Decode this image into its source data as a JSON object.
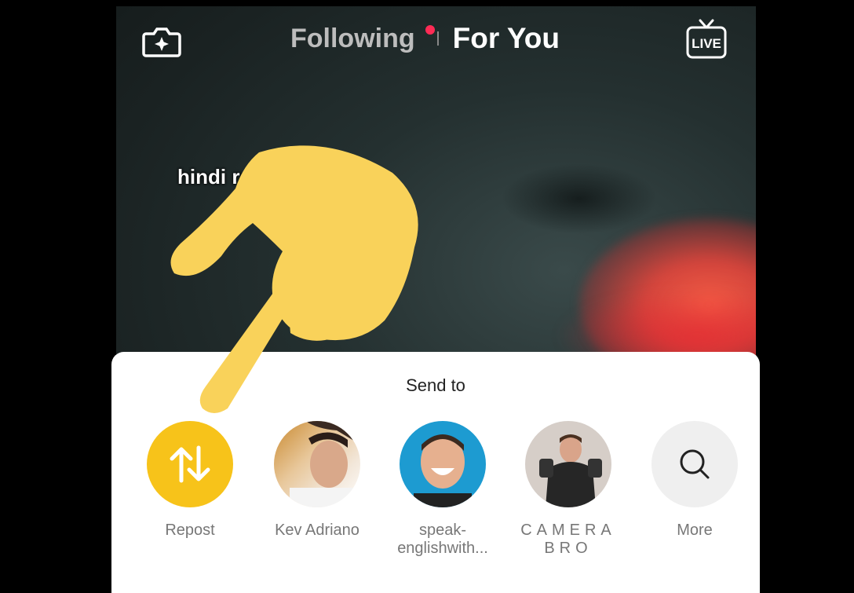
{
  "topbar": {
    "following_label": "Following",
    "for_you_label": "For You",
    "camera_icon": "camera-plus-icon",
    "live_icon": "live-tv-icon",
    "live_text": "LIVE",
    "notification_dot_color": "#ff2b55"
  },
  "video": {
    "caption": "hindi ras pt5"
  },
  "share_sheet": {
    "title": "Send to",
    "contacts": [
      {
        "label": "Repost",
        "icon": "repost-icon",
        "color": "#f7c31a"
      },
      {
        "label": "Kev Adriano",
        "icon": "avatar"
      },
      {
        "label_line1": "speak-",
        "label_line2": "englishwith...",
        "icon": "avatar",
        "color": "#1d9bd1"
      },
      {
        "label_line1": "CAMERA",
        "label_line2": "BRO",
        "icon": "avatar"
      },
      {
        "label": "More",
        "icon": "search-icon"
      }
    ]
  },
  "overlay": {
    "pointer": "pointing-hand-icon",
    "color": "#f9d25a"
  }
}
